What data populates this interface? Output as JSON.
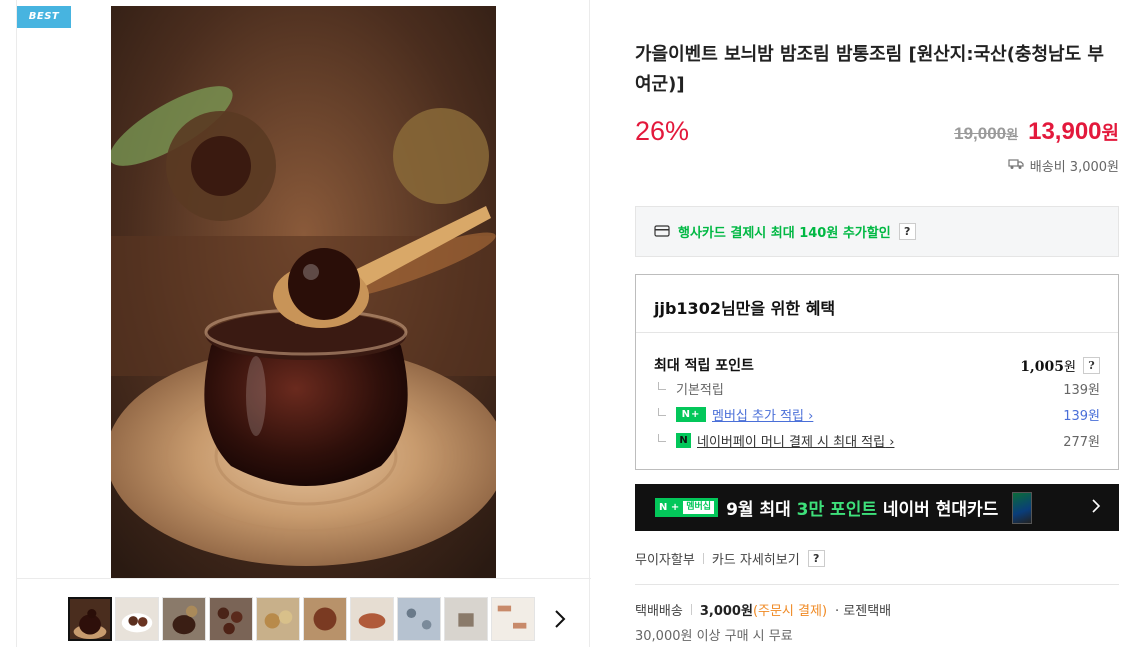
{
  "badge": {
    "label": "BEST"
  },
  "product": {
    "title": "가을이벤트 보늬밤 밤조림 밤통조림 [원산지:국산(충청남도 부여군)]",
    "discount_rate": "26%",
    "original_price": "19,000",
    "original_unit": "원",
    "sale_price": "13,900",
    "sale_unit": "원",
    "shipping_fee": "배송비 3,000원"
  },
  "card_discount": {
    "text": "행사카드 결제시 최대 140원 추가할인",
    "help": "?"
  },
  "benefit": {
    "title": "jjb1302님만을 위한 혜택",
    "max_points_label": "최대 적립 포인트",
    "max_points_value": "1,005",
    "max_points_unit": "원",
    "help": "?",
    "items": [
      {
        "label": "기본적립",
        "value": "139원"
      },
      {
        "label": "멤버십 추가 적립",
        "value": "139원",
        "badge": "N+"
      },
      {
        "label": "네이버페이 머니 결제 시 최대 적립",
        "value": "277원",
        "badge": "N"
      }
    ]
  },
  "promo": {
    "badge_left": "N +",
    "badge_right": "멤버십",
    "text_before": "9월 최대 ",
    "text_highlight": "3만 포인트",
    "text_after": " 네이버 현대카드"
  },
  "installment": {
    "label": "무이자할부",
    "card_detail": "카드 자세히보기",
    "help": "?"
  },
  "delivery": {
    "type": "택배배송",
    "price": "3,000원",
    "note": "(주문시 결제)",
    "carrier": "· 로젠택배",
    "free_condition": "30,000원 이상 구매 시 무료"
  },
  "icons": {
    "truck": "truck-icon",
    "card": "credit-card-icon",
    "next": "chevron-right-icon"
  },
  "colors": {
    "accent_red": "#e3193c",
    "naver_green": "#03c75a",
    "badge_blue": "#47b4e0"
  }
}
